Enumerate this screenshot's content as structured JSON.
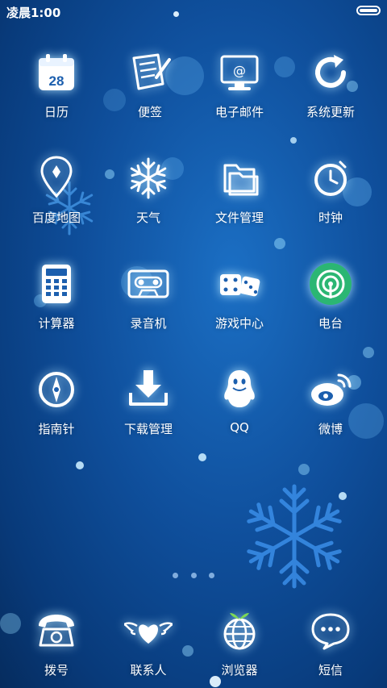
{
  "status_bar": {
    "time": "凌晨1:00"
  },
  "apps": {
    "calendar": {
      "label": "日历",
      "day": "28"
    },
    "notes": {
      "label": "便签"
    },
    "email": {
      "label": "电子邮件"
    },
    "update": {
      "label": "系统更新"
    },
    "maps": {
      "label": "百度地图"
    },
    "weather": {
      "label": "天气"
    },
    "files": {
      "label": "文件管理"
    },
    "clock": {
      "label": "时钟"
    },
    "calculator": {
      "label": "计算器"
    },
    "recorder": {
      "label": "录音机"
    },
    "games": {
      "label": "游戏中心"
    },
    "radio": {
      "label": "电台"
    },
    "compass": {
      "label": "指南针"
    },
    "downloads": {
      "label": "下载管理"
    },
    "qq": {
      "label": "QQ"
    },
    "weibo": {
      "label": "微博"
    }
  },
  "pager": {
    "pages": 3,
    "current": 1
  },
  "dock": {
    "dialer": {
      "label": "拨号"
    },
    "contacts": {
      "label": "联系人"
    },
    "browser": {
      "label": "浏览器"
    },
    "messages": {
      "label": "短信"
    }
  },
  "colors": {
    "background": "#0f4f9c",
    "radio_icon": "#2bb673",
    "icon_stroke": "#ffffff"
  }
}
